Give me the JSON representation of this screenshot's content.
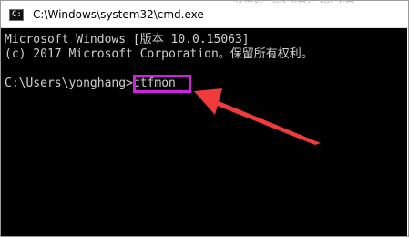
{
  "window": {
    "title": "C:\\Windows\\system32\\cmd.exe",
    "icon": "cmd-icon"
  },
  "background": {
    "partial_text": "系统，输入法，输入法"
  },
  "console": {
    "lines": [
      "Microsoft Windows [版本 10.0.15063]",
      "(c) 2017 Microsoft Corporation。保留所有权利。"
    ],
    "prompt": "C:\\Users\\yonghang>",
    "command": "ctfmon"
  },
  "annotation": {
    "highlight_color": "#d41ee6",
    "arrow_color": "#ef3b3b"
  }
}
